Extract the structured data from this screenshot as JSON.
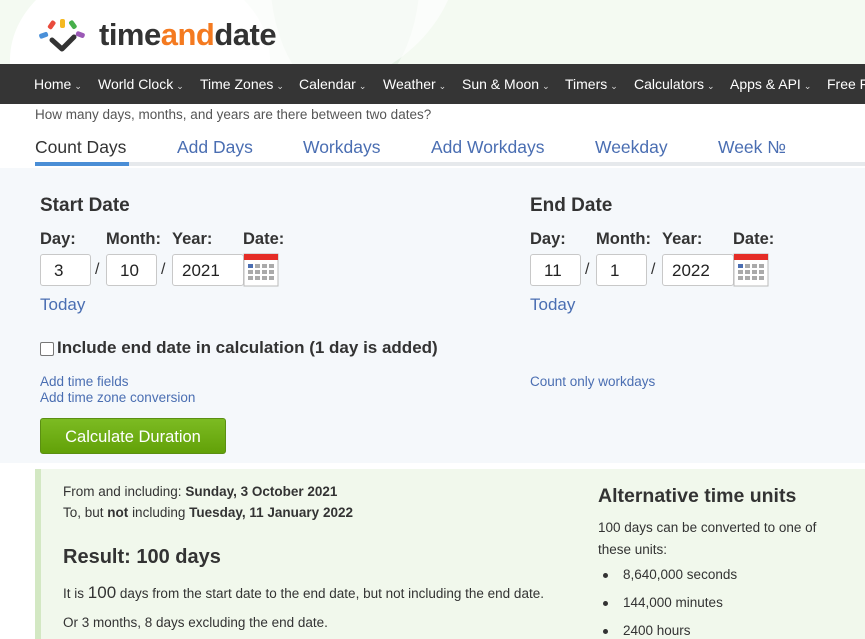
{
  "brand": {
    "part1": "time",
    "part2": "and",
    "part3": "date",
    "colors": {
      "accent": "#f47a20",
      "dark": "#333333",
      "nav": "#353535",
      "link": "#4a6eb2",
      "button": "#6aae10"
    }
  },
  "nav": {
    "items": [
      {
        "label": "Home"
      },
      {
        "label": "World Clock"
      },
      {
        "label": "Time Zones"
      },
      {
        "label": "Calendar"
      },
      {
        "label": "Weather"
      },
      {
        "label": "Sun & Moon"
      },
      {
        "label": "Timers"
      },
      {
        "label": "Calculators"
      },
      {
        "label": "Apps & API"
      },
      {
        "label": "Free F"
      }
    ],
    "caret": "⌄"
  },
  "page": {
    "subtitle": "How many days, months, and years are there between two dates?"
  },
  "tabs": [
    {
      "label": "Count Days",
      "active": true
    },
    {
      "label": "Add Days"
    },
    {
      "label": "Workdays"
    },
    {
      "label": "Add Workdays"
    },
    {
      "label": "Weekday"
    },
    {
      "label": "Week №"
    }
  ],
  "form": {
    "start": {
      "heading": "Start Date",
      "day_label": "Day:",
      "month_label": "Month:",
      "year_label": "Year:",
      "date_label": "Date:",
      "day": "3",
      "month": "10",
      "year": "2021",
      "today": "Today",
      "sep": "/"
    },
    "end": {
      "heading": "End Date",
      "day_label": "Day:",
      "month_label": "Month:",
      "year_label": "Year:",
      "date_label": "Date:",
      "day": "11",
      "month": "1",
      "year": "2022",
      "today": "Today",
      "sep": "/"
    },
    "include_end_label": "Include end date in calculation (1 day is added)",
    "include_end_checked": false,
    "add_time_fields": "Add time fields",
    "add_tz_conversion": "Add time zone conversion",
    "count_workdays": "Count only workdays",
    "calculate_button": "Calculate Duration",
    "calendar_icon": "calendar-icon"
  },
  "result": {
    "from_prefix": "From and including:",
    "from_date": "Sunday, 3 October 2021",
    "to_prefix1": "To, but",
    "to_not": "not",
    "to_prefix2": "including",
    "to_date": "Tuesday, 11 January 2022",
    "result_label": "Result: 100 days",
    "line1_pre": "It is",
    "line1_num": "100",
    "line1_post": "days from the start date to the end date, but not including the end date.",
    "line2": "Or 3 months, 8 days excluding the end date."
  },
  "alternative": {
    "heading": "Alternative time units",
    "intro": "100 days can be converted to one of these units:",
    "items": [
      "8,640,000 seconds",
      "144,000 minutes",
      "2400 hours"
    ]
  }
}
